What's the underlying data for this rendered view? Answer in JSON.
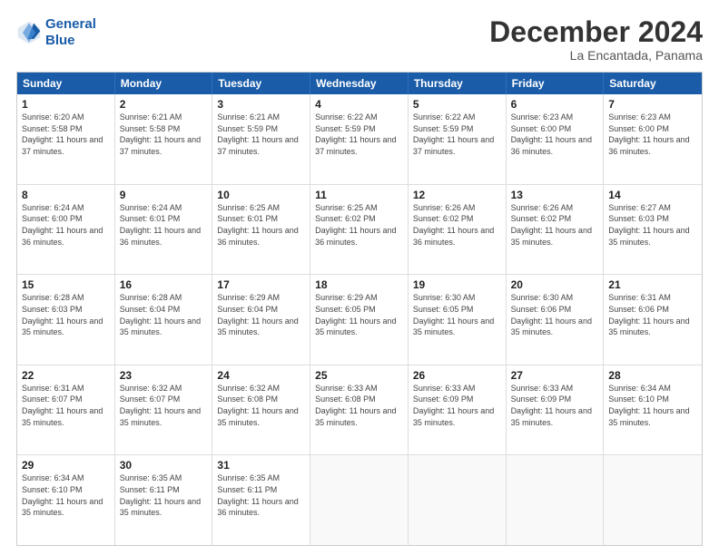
{
  "header": {
    "logo_line1": "General",
    "logo_line2": "Blue",
    "month": "December 2024",
    "location": "La Encantada, Panama"
  },
  "days_of_week": [
    "Sunday",
    "Monday",
    "Tuesday",
    "Wednesday",
    "Thursday",
    "Friday",
    "Saturday"
  ],
  "weeks": [
    [
      {
        "day": "1",
        "rise": "6:20 AM",
        "set": "5:58 PM",
        "daylight": "11 hours and 37 minutes"
      },
      {
        "day": "2",
        "rise": "6:21 AM",
        "set": "5:58 PM",
        "daylight": "11 hours and 37 minutes"
      },
      {
        "day": "3",
        "rise": "6:21 AM",
        "set": "5:59 PM",
        "daylight": "11 hours and 37 minutes"
      },
      {
        "day": "4",
        "rise": "6:22 AM",
        "set": "5:59 PM",
        "daylight": "11 hours and 37 minutes"
      },
      {
        "day": "5",
        "rise": "6:22 AM",
        "set": "5:59 PM",
        "daylight": "11 hours and 37 minutes"
      },
      {
        "day": "6",
        "rise": "6:23 AM",
        "set": "6:00 PM",
        "daylight": "11 hours and 36 minutes"
      },
      {
        "day": "7",
        "rise": "6:23 AM",
        "set": "6:00 PM",
        "daylight": "11 hours and 36 minutes"
      }
    ],
    [
      {
        "day": "8",
        "rise": "6:24 AM",
        "set": "6:00 PM",
        "daylight": "11 hours and 36 minutes"
      },
      {
        "day": "9",
        "rise": "6:24 AM",
        "set": "6:01 PM",
        "daylight": "11 hours and 36 minutes"
      },
      {
        "day": "10",
        "rise": "6:25 AM",
        "set": "6:01 PM",
        "daylight": "11 hours and 36 minutes"
      },
      {
        "day": "11",
        "rise": "6:25 AM",
        "set": "6:02 PM",
        "daylight": "11 hours and 36 minutes"
      },
      {
        "day": "12",
        "rise": "6:26 AM",
        "set": "6:02 PM",
        "daylight": "11 hours and 36 minutes"
      },
      {
        "day": "13",
        "rise": "6:26 AM",
        "set": "6:02 PM",
        "daylight": "11 hours and 35 minutes"
      },
      {
        "day": "14",
        "rise": "6:27 AM",
        "set": "6:03 PM",
        "daylight": "11 hours and 35 minutes"
      }
    ],
    [
      {
        "day": "15",
        "rise": "6:28 AM",
        "set": "6:03 PM",
        "daylight": "11 hours and 35 minutes"
      },
      {
        "day": "16",
        "rise": "6:28 AM",
        "set": "6:04 PM",
        "daylight": "11 hours and 35 minutes"
      },
      {
        "day": "17",
        "rise": "6:29 AM",
        "set": "6:04 PM",
        "daylight": "11 hours and 35 minutes"
      },
      {
        "day": "18",
        "rise": "6:29 AM",
        "set": "6:05 PM",
        "daylight": "11 hours and 35 minutes"
      },
      {
        "day": "19",
        "rise": "6:30 AM",
        "set": "6:05 PM",
        "daylight": "11 hours and 35 minutes"
      },
      {
        "day": "20",
        "rise": "6:30 AM",
        "set": "6:06 PM",
        "daylight": "11 hours and 35 minutes"
      },
      {
        "day": "21",
        "rise": "6:31 AM",
        "set": "6:06 PM",
        "daylight": "11 hours and 35 minutes"
      }
    ],
    [
      {
        "day": "22",
        "rise": "6:31 AM",
        "set": "6:07 PM",
        "daylight": "11 hours and 35 minutes"
      },
      {
        "day": "23",
        "rise": "6:32 AM",
        "set": "6:07 PM",
        "daylight": "11 hours and 35 minutes"
      },
      {
        "day": "24",
        "rise": "6:32 AM",
        "set": "6:08 PM",
        "daylight": "11 hours and 35 minutes"
      },
      {
        "day": "25",
        "rise": "6:33 AM",
        "set": "6:08 PM",
        "daylight": "11 hours and 35 minutes"
      },
      {
        "day": "26",
        "rise": "6:33 AM",
        "set": "6:09 PM",
        "daylight": "11 hours and 35 minutes"
      },
      {
        "day": "27",
        "rise": "6:33 AM",
        "set": "6:09 PM",
        "daylight": "11 hours and 35 minutes"
      },
      {
        "day": "28",
        "rise": "6:34 AM",
        "set": "6:10 PM",
        "daylight": "11 hours and 35 minutes"
      }
    ],
    [
      {
        "day": "29",
        "rise": "6:34 AM",
        "set": "6:10 PM",
        "daylight": "11 hours and 35 minutes"
      },
      {
        "day": "30",
        "rise": "6:35 AM",
        "set": "6:11 PM",
        "daylight": "11 hours and 35 minutes"
      },
      {
        "day": "31",
        "rise": "6:35 AM",
        "set": "6:11 PM",
        "daylight": "11 hours and 36 minutes"
      },
      null,
      null,
      null,
      null
    ]
  ]
}
